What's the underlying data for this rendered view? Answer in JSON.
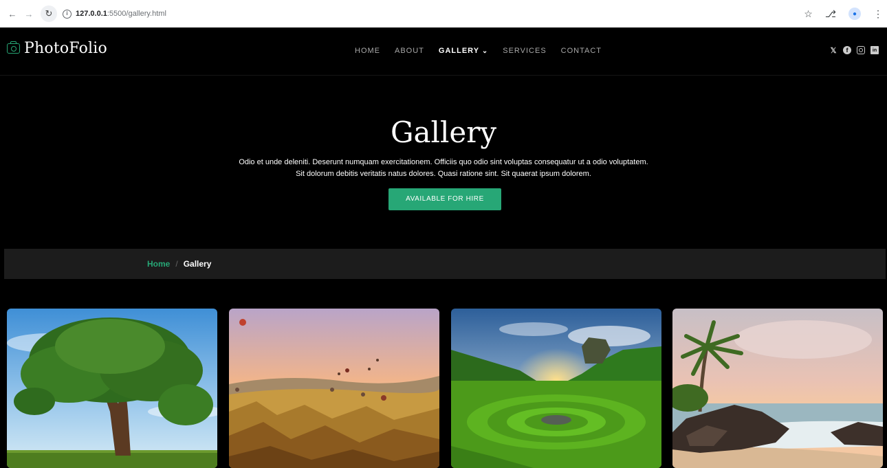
{
  "browser": {
    "url_host": "127.0.0.1",
    "url_path": ":5500/gallery.html"
  },
  "header": {
    "logo_text": "PhotoFolio",
    "nav": [
      "HOME",
      "ABOUT",
      "GALLERY",
      "SERVICES",
      "CONTACT"
    ],
    "active_nav": "GALLERY",
    "socials": [
      "x-icon",
      "facebook-icon",
      "instagram-icon",
      "linkedin-icon"
    ]
  },
  "hero": {
    "title": "Gallery",
    "description": "Odio et unde deleniti. Deserunt numquam exercitationem. Officiis quo odio sint voluptas consequatur ut a odio voluptatem. Sit dolorum debitis veritatis natus dolores. Quasi ratione sint. Sit quaerat ipsum dolorem.",
    "button_label": "AVAILABLE FOR HIRE"
  },
  "breadcrumb": {
    "home": "Home",
    "separator": "/",
    "current": "Gallery"
  },
  "gallery": {
    "images": [
      "tree-photo",
      "balloons-landscape-photo",
      "green-valley-sunset-photo",
      "tropical-beach-photo"
    ]
  },
  "colors": {
    "accent": "#27a776",
    "background": "#000000",
    "breadcrumb_bg": "#1c1c1c"
  }
}
